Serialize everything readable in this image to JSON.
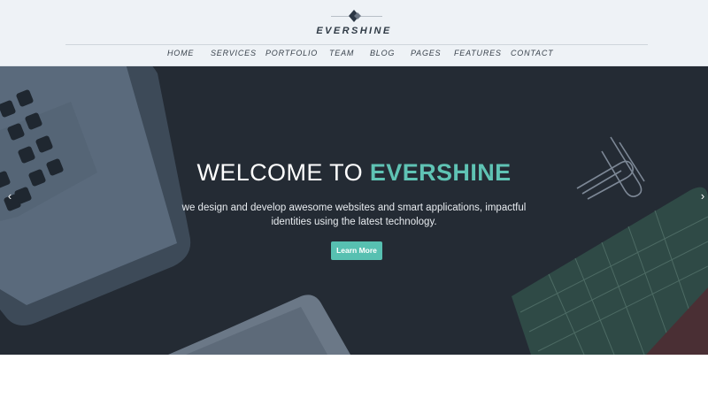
{
  "brand": {
    "name": "EVERSHINE"
  },
  "nav": {
    "items": [
      "HOME",
      "SERVICES",
      "PORTFOLIO",
      "TEAM",
      "BLOG",
      "PAGES",
      "FEATURES",
      "CONTACT"
    ]
  },
  "hero": {
    "title_prefix": "WELCOME TO",
    "title_accent": "EVERSHINE",
    "subtitle": "we design and develop awesome websites and smart applications, impactful identities using the latest technology.",
    "cta_label": "Learn More",
    "prev_arrow": "‹",
    "next_arrow": "›"
  },
  "colors": {
    "accent": "#5fc3b4",
    "hero_bg": "#242b34",
    "header_bg": "#eef2f6"
  },
  "icons": {
    "prev": "chevron-left-icon",
    "next": "chevron-right-icon",
    "logo": "diamond-logo-icon"
  }
}
